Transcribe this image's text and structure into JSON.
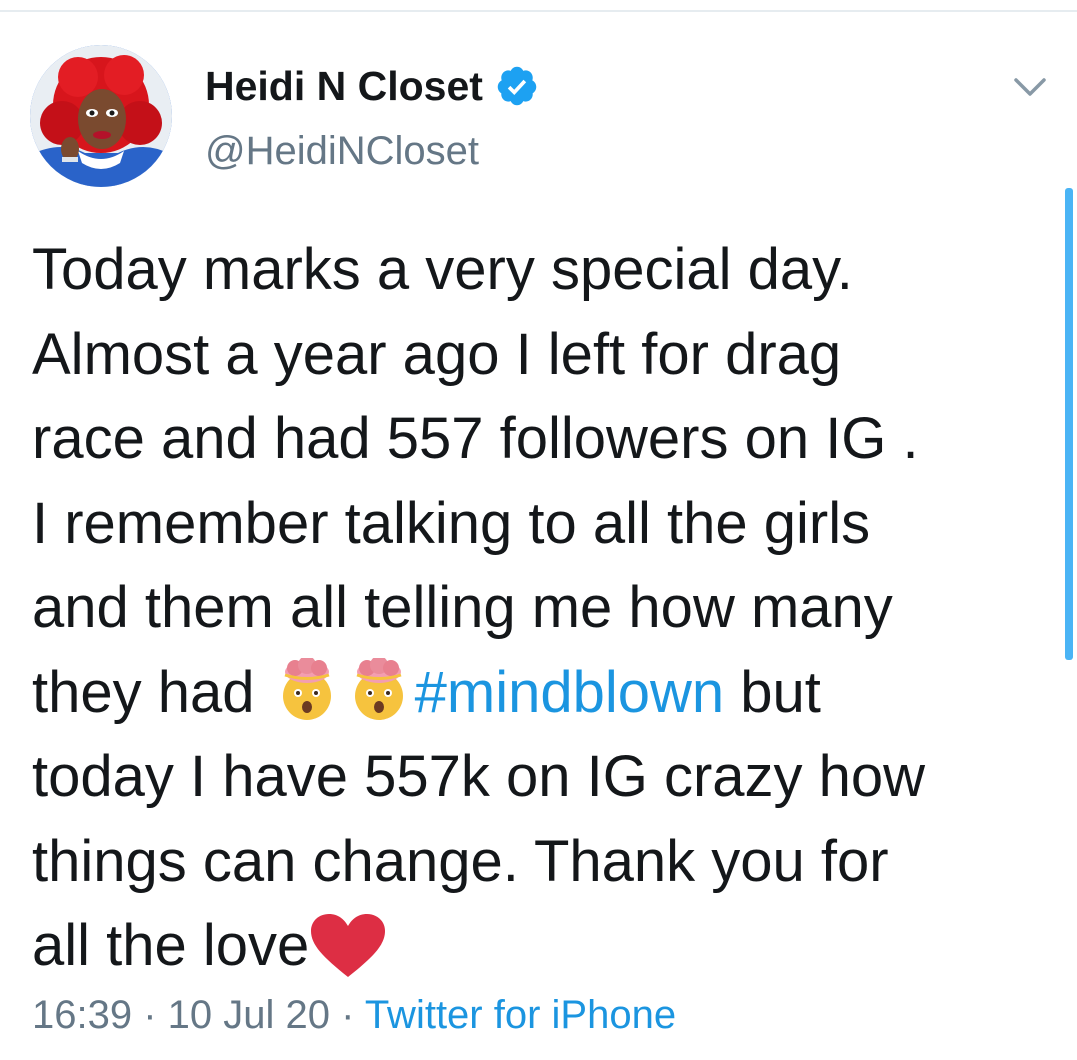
{
  "user": {
    "display_name": "Heidi N Closet",
    "handle": "@HeidiNCloset"
  },
  "tweet": {
    "line1": "Today marks a very special day.",
    "line2": "Almost a year ago I left for drag",
    "line3": "race and had 557 followers on IG .",
    "line4": "I remember talking to all the girls",
    "line5": "and them all telling me how many",
    "line6_pre": "they had ",
    "hashtag": "#mindblown",
    "line6_post": " but",
    "line7": "today I have 557k on IG crazy how",
    "line8": "things can change. Thank you for",
    "line9": "all the love"
  },
  "meta": {
    "time": "16:39",
    "separator1": " · ",
    "date": "10 Jul 20",
    "separator2": " · ",
    "source": "Twitter for iPhone"
  },
  "icons": {
    "verified": "verified-badge-icon",
    "chevron": "chevron-down-icon",
    "emoji": "exploding-head-emoji",
    "heart": "red-heart-emoji"
  },
  "colors": {
    "link": "#1b95e0",
    "secondary_text": "#657786",
    "verified": "#1da1f2",
    "heart": "#dd2e44"
  }
}
